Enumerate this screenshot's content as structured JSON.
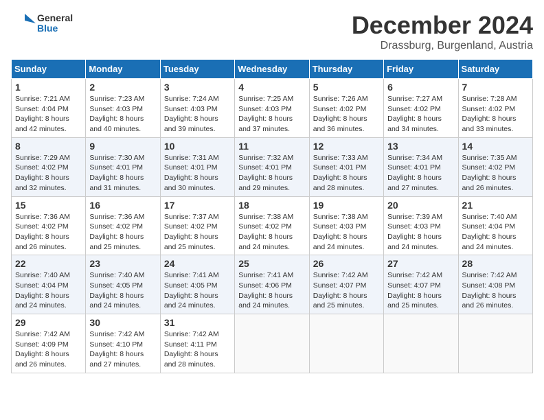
{
  "logo": {
    "general": "General",
    "blue": "Blue"
  },
  "header": {
    "month": "December 2024",
    "location": "Drassburg, Burgenland, Austria"
  },
  "weekdays": [
    "Sunday",
    "Monday",
    "Tuesday",
    "Wednesday",
    "Thursday",
    "Friday",
    "Saturday"
  ],
  "weeks": [
    [
      {
        "day": "1",
        "sunrise": "7:21 AM",
        "sunset": "4:04 PM",
        "daylight": "8 hours and 42 minutes."
      },
      {
        "day": "2",
        "sunrise": "7:23 AM",
        "sunset": "4:03 PM",
        "daylight": "8 hours and 40 minutes."
      },
      {
        "day": "3",
        "sunrise": "7:24 AM",
        "sunset": "4:03 PM",
        "daylight": "8 hours and 39 minutes."
      },
      {
        "day": "4",
        "sunrise": "7:25 AM",
        "sunset": "4:03 PM",
        "daylight": "8 hours and 37 minutes."
      },
      {
        "day": "5",
        "sunrise": "7:26 AM",
        "sunset": "4:02 PM",
        "daylight": "8 hours and 36 minutes."
      },
      {
        "day": "6",
        "sunrise": "7:27 AM",
        "sunset": "4:02 PM",
        "daylight": "8 hours and 34 minutes."
      },
      {
        "day": "7",
        "sunrise": "7:28 AM",
        "sunset": "4:02 PM",
        "daylight": "8 hours and 33 minutes."
      }
    ],
    [
      {
        "day": "8",
        "sunrise": "7:29 AM",
        "sunset": "4:02 PM",
        "daylight": "8 hours and 32 minutes."
      },
      {
        "day": "9",
        "sunrise": "7:30 AM",
        "sunset": "4:01 PM",
        "daylight": "8 hours and 31 minutes."
      },
      {
        "day": "10",
        "sunrise": "7:31 AM",
        "sunset": "4:01 PM",
        "daylight": "8 hours and 30 minutes."
      },
      {
        "day": "11",
        "sunrise": "7:32 AM",
        "sunset": "4:01 PM",
        "daylight": "8 hours and 29 minutes."
      },
      {
        "day": "12",
        "sunrise": "7:33 AM",
        "sunset": "4:01 PM",
        "daylight": "8 hours and 28 minutes."
      },
      {
        "day": "13",
        "sunrise": "7:34 AM",
        "sunset": "4:01 PM",
        "daylight": "8 hours and 27 minutes."
      },
      {
        "day": "14",
        "sunrise": "7:35 AM",
        "sunset": "4:02 PM",
        "daylight": "8 hours and 26 minutes."
      }
    ],
    [
      {
        "day": "15",
        "sunrise": "7:36 AM",
        "sunset": "4:02 PM",
        "daylight": "8 hours and 26 minutes."
      },
      {
        "day": "16",
        "sunrise": "7:36 AM",
        "sunset": "4:02 PM",
        "daylight": "8 hours and 25 minutes."
      },
      {
        "day": "17",
        "sunrise": "7:37 AM",
        "sunset": "4:02 PM",
        "daylight": "8 hours and 25 minutes."
      },
      {
        "day": "18",
        "sunrise": "7:38 AM",
        "sunset": "4:02 PM",
        "daylight": "8 hours and 24 minutes."
      },
      {
        "day": "19",
        "sunrise": "7:38 AM",
        "sunset": "4:03 PM",
        "daylight": "8 hours and 24 minutes."
      },
      {
        "day": "20",
        "sunrise": "7:39 AM",
        "sunset": "4:03 PM",
        "daylight": "8 hours and 24 minutes."
      },
      {
        "day": "21",
        "sunrise": "7:40 AM",
        "sunset": "4:04 PM",
        "daylight": "8 hours and 24 minutes."
      }
    ],
    [
      {
        "day": "22",
        "sunrise": "7:40 AM",
        "sunset": "4:04 PM",
        "daylight": "8 hours and 24 minutes."
      },
      {
        "day": "23",
        "sunrise": "7:40 AM",
        "sunset": "4:05 PM",
        "daylight": "8 hours and 24 minutes."
      },
      {
        "day": "24",
        "sunrise": "7:41 AM",
        "sunset": "4:05 PM",
        "daylight": "8 hours and 24 minutes."
      },
      {
        "day": "25",
        "sunrise": "7:41 AM",
        "sunset": "4:06 PM",
        "daylight": "8 hours and 24 minutes."
      },
      {
        "day": "26",
        "sunrise": "7:42 AM",
        "sunset": "4:07 PM",
        "daylight": "8 hours and 25 minutes."
      },
      {
        "day": "27",
        "sunrise": "7:42 AM",
        "sunset": "4:07 PM",
        "daylight": "8 hours and 25 minutes."
      },
      {
        "day": "28",
        "sunrise": "7:42 AM",
        "sunset": "4:08 PM",
        "daylight": "8 hours and 26 minutes."
      }
    ],
    [
      {
        "day": "29",
        "sunrise": "7:42 AM",
        "sunset": "4:09 PM",
        "daylight": "8 hours and 26 minutes."
      },
      {
        "day": "30",
        "sunrise": "7:42 AM",
        "sunset": "4:10 PM",
        "daylight": "8 hours and 27 minutes."
      },
      {
        "day": "31",
        "sunrise": "7:42 AM",
        "sunset": "4:11 PM",
        "daylight": "8 hours and 28 minutes."
      },
      null,
      null,
      null,
      null
    ]
  ]
}
